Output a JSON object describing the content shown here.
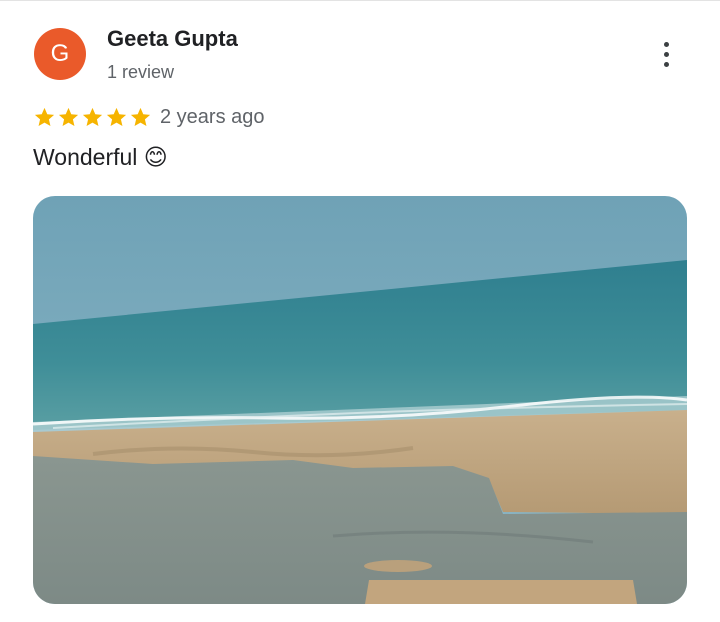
{
  "review": {
    "avatar_letter": "G",
    "reviewer_name": "Geeta Gupta",
    "reviewer_meta": "1 review",
    "rating": 5,
    "time_ago": "2 years ago",
    "text": "Wonderful 😊",
    "photo_alt": "Beach and sea view"
  },
  "icons": {
    "more": "more-vert-icon",
    "star": "star-icon"
  },
  "colors": {
    "avatar": "#ea5a2a",
    "star": "#f6b400",
    "name": "#202124",
    "secondary": "#5f6368"
  }
}
